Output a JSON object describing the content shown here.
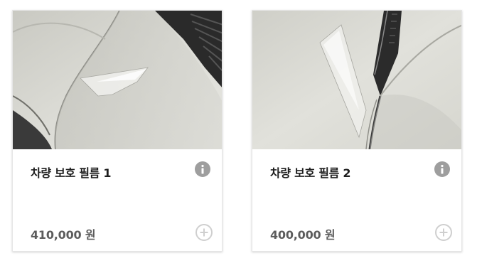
{
  "products": [
    {
      "title": "차량 보호 필름 1",
      "price": "410,000 원",
      "image_alt": "door edge protection film photo",
      "info_icon": "info-icon",
      "add_icon": "plus-circle-icon"
    },
    {
      "title": "차량 보호 필름 2",
      "price": "400,000 원",
      "image_alt": "door handle cup protection film photo",
      "info_icon": "info-icon",
      "add_icon": "plus-circle-icon"
    }
  ],
  "colors": {
    "title_text": "#1e1e1e",
    "price_text": "#5c5c5c",
    "info_icon_bg": "#9e9e9e",
    "add_icon_ring": "#cfcfcf"
  }
}
